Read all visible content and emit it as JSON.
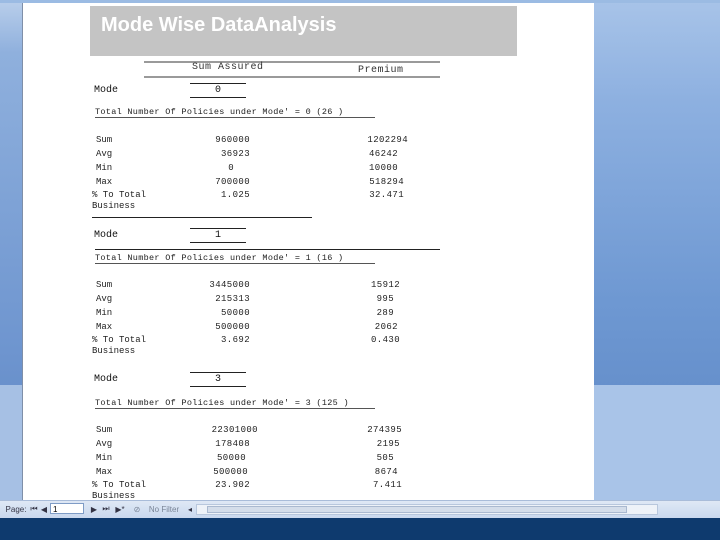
{
  "report": {
    "title": "Mode Wise DataAnalysis",
    "col_sum_assured": "Sum Assured",
    "col_premium": "Premium",
    "mode_label": "Mode",
    "row_labels": {
      "sum": "Sum",
      "avg": "Avg",
      "min": "Min",
      "max": "Max",
      "pct1": "% To Total",
      "pct2": "Business"
    },
    "groups": [
      {
        "mode": "0",
        "total_text": "Total Number Of Policies under Mode' =  0 (26  )",
        "sum": [
          "960000",
          "1202294"
        ],
        "avg": [
          "36923",
          "46242"
        ],
        "min": [
          "0",
          "10000"
        ],
        "max": [
          "700000",
          "518294"
        ],
        "pct": [
          "1.025",
          "32.471"
        ]
      },
      {
        "mode": "1",
        "total_text": "Total Number Of Policies under Mode' =  1 (16  )",
        "sum": [
          "3445000",
          "15912"
        ],
        "avg": [
          "215313",
          "995"
        ],
        "min": [
          "50000",
          "289"
        ],
        "max": [
          "500000",
          "2062"
        ],
        "pct": [
          "3.692",
          "0.430"
        ]
      },
      {
        "mode": "3",
        "total_text": "Total Number Of Policies under Mode' =  3 (125  )",
        "sum": [
          "22301000",
          "274395"
        ],
        "avg": [
          "178408",
          "2195"
        ],
        "min": [
          "50000",
          "505"
        ],
        "max": [
          "500000",
          "8674"
        ],
        "pct": [
          "23.902",
          "7.411"
        ]
      }
    ]
  },
  "nav": {
    "page_label": "Page:",
    "page_value": "1",
    "first": "⏮",
    "prev": "◀",
    "next": "▶",
    "last": "⏭",
    "new": "▶*",
    "filter_label": "No Filter",
    "search_marker": "◂"
  }
}
